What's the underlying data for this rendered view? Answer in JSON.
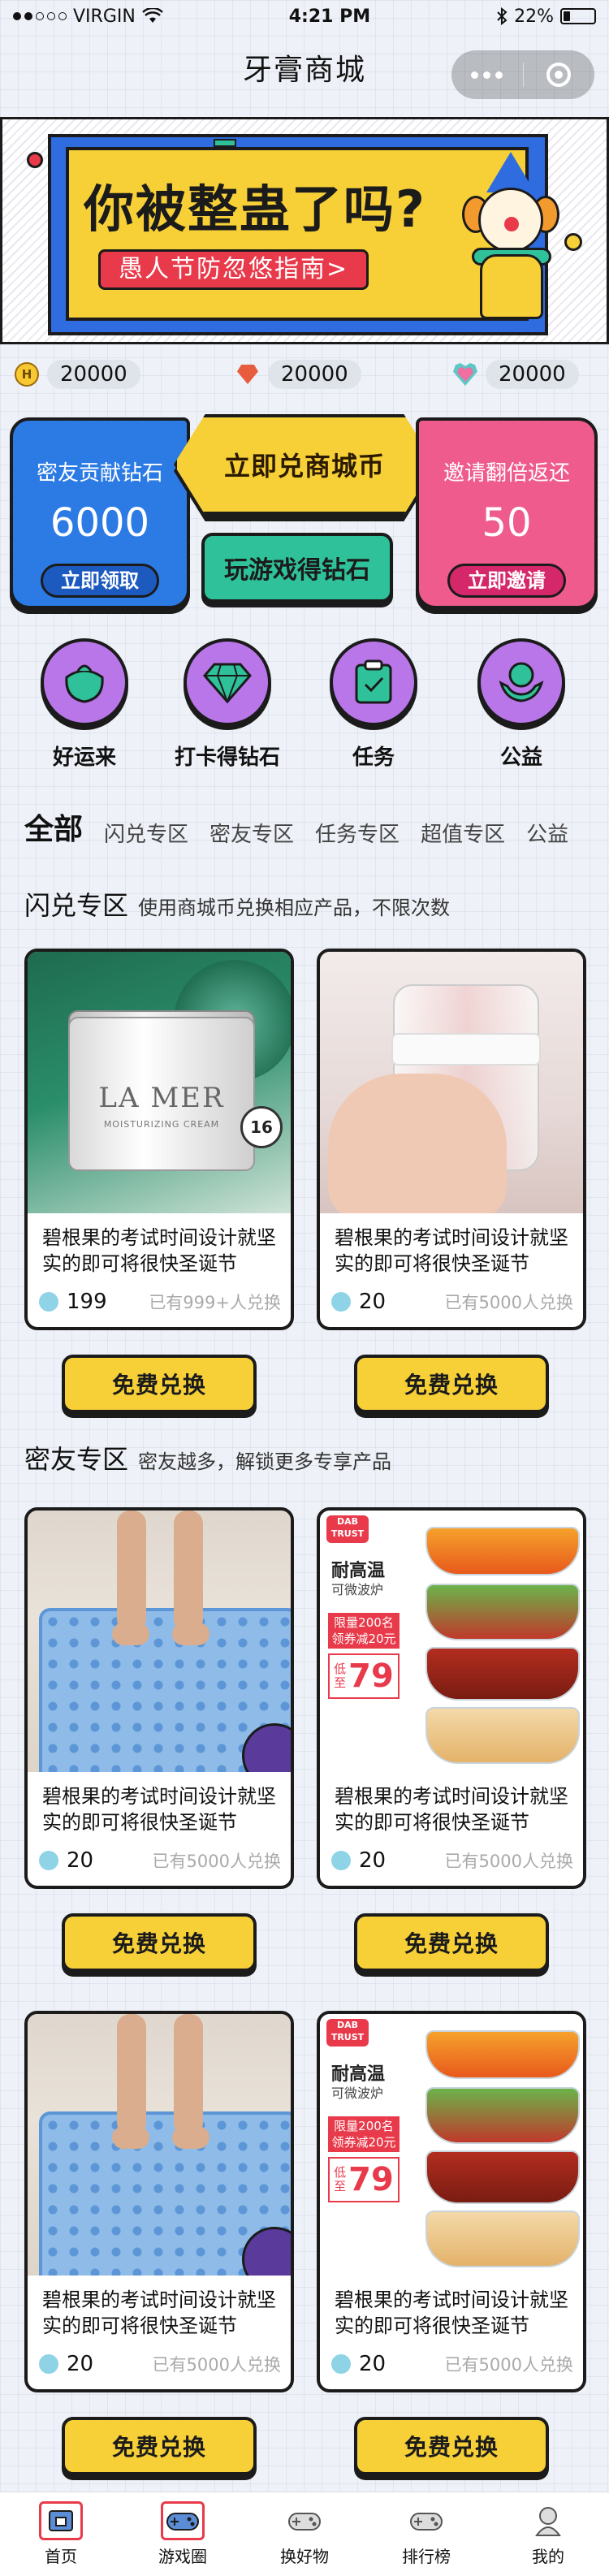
{
  "status_bar": {
    "carrier": "VIRGIN",
    "time": "4:21 PM",
    "battery": "22%"
  },
  "nav": {
    "title": "牙膏商城"
  },
  "banner": {
    "headline": "你被整蛊了吗?",
    "subline": "愚人节防忽悠指南>"
  },
  "balances": [
    {
      "icon": "coin-icon",
      "value": "20000"
    },
    {
      "icon": "diamond-icon",
      "value": "20000"
    },
    {
      "icon": "heart-icon",
      "value": "20000"
    }
  ],
  "task_cards": {
    "left": {
      "label": "密友贡献钻石",
      "value": "6000",
      "button": "立即领取"
    },
    "center_top": "立即兑商城币",
    "center_bottom": "玩游戏得钻石",
    "right": {
      "label": "邀请翻倍返还",
      "value": "50",
      "button": "立即邀请"
    }
  },
  "shortcuts": [
    {
      "label": "好运来",
      "icon": "fruit-icon"
    },
    {
      "label": "打卡得钻石",
      "icon": "diamond-icon"
    },
    {
      "label": "任务",
      "icon": "clipboard-icon"
    },
    {
      "label": "公益",
      "icon": "hands-heart-icon"
    }
  ],
  "tabs": [
    "全部",
    "闪兑专区",
    "密友专区",
    "任务专区",
    "超值专区",
    "公益"
  ],
  "sections": [
    {
      "title": "闪兑专区",
      "desc": "使用商城币兑换相应产品，不限次数"
    },
    {
      "title": "密友专区",
      "desc": "密友越多，解锁更多专享产品"
    }
  ],
  "product_image_text": {
    "lamer_brand": "LA MER",
    "lamer_small": "MOISTURIZING CREAM",
    "lamer_badge": "16",
    "bowls_logo": "DAB TRUST",
    "bowls_t1": "耐高温",
    "bowls_t2": "可微波炉",
    "bowls_tag": "限量200名 领券减20元",
    "bowls_price_label": "低至",
    "bowls_price": "79"
  },
  "products": [
    {
      "title": "碧根果的考试时间设计就坚实的即可将很快圣诞节",
      "price": "199",
      "count": "已有999+人兑换",
      "button": "免费兑换"
    },
    {
      "title": "碧根果的考试时间设计就坚实的即可将很快圣诞节",
      "price": "20",
      "count": "已有5000人兑换",
      "button": "免费兑换"
    },
    {
      "title": "碧根果的考试时间设计就坚实的即可将很快圣诞节",
      "price": "20",
      "count": "已有5000人兑换",
      "button": "免费兑换"
    },
    {
      "title": "碧根果的考试时间设计就坚实的即可将很快圣诞节",
      "price": "20",
      "count": "已有5000人兑换",
      "button": "免费兑换"
    },
    {
      "title": "碧根果的考试时间设计就坚实的即可将很快圣诞节",
      "price": "20",
      "count": "已有5000人兑换",
      "button": "免费兑换"
    },
    {
      "title": "碧根果的考试时间设计就坚实的即可将很快圣诞节",
      "price": "20",
      "count": "已有5000人兑换",
      "button": "免费兑换"
    }
  ],
  "tabbar": [
    {
      "label": "首页",
      "icon": "home-icon",
      "selected": true
    },
    {
      "label": "游戏圈",
      "icon": "gamepad-icon",
      "selected": true
    },
    {
      "label": "换好物",
      "icon": "gamepad-icon",
      "selected": false
    },
    {
      "label": "排行榜",
      "icon": "gamepad-icon",
      "selected": false
    },
    {
      "label": "我的",
      "icon": "user-icon",
      "selected": false
    }
  ],
  "colors": {
    "accent_yellow": "#f7d038",
    "accent_blue": "#2c7be5",
    "accent_pink": "#ef5b8d",
    "accent_green": "#2fc29a",
    "accent_purple": "#b976e8",
    "accent_red": "#e83a4a"
  }
}
